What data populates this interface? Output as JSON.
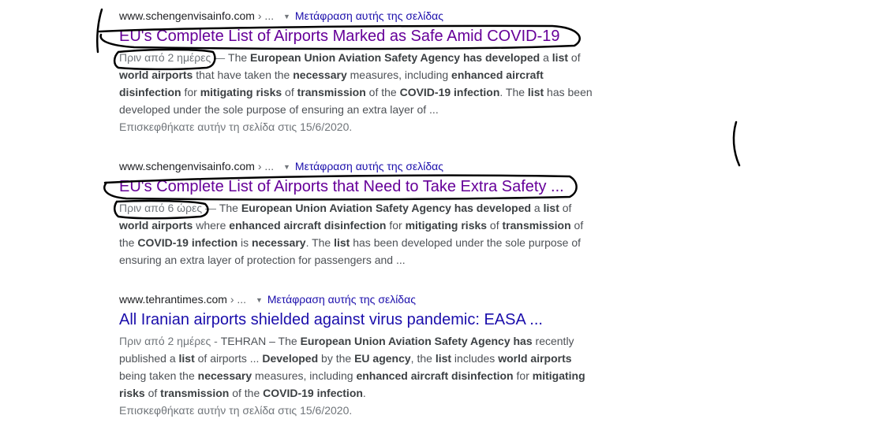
{
  "results": [
    {
      "cite_domain": "www.schengenvisainfo.com",
      "cite_path": " › ...",
      "translate_label": "Μετάφραση αυτής της σελίδας",
      "title": "EU's Complete List of Airports Marked as Safe Amid COVID-19",
      "date": "Πριν από 2 ημέρες",
      "date_sep": " — ",
      "snippet_parts": [
        {
          "t": "The ",
          "b": false
        },
        {
          "t": "European Union Aviation Safety Agency has developed",
          "b": true
        },
        {
          "t": " a ",
          "b": false
        },
        {
          "t": "list",
          "b": true
        },
        {
          "t": " of ",
          "b": false
        },
        {
          "t": "world airports",
          "b": true
        },
        {
          "t": " that have taken the ",
          "b": false
        },
        {
          "t": "necessary",
          "b": true
        },
        {
          "t": " measures, including ",
          "b": false
        },
        {
          "t": "enhanced aircraft disinfection",
          "b": true
        },
        {
          "t": " for ",
          "b": false
        },
        {
          "t": "mitigating risks",
          "b": true
        },
        {
          "t": " of ",
          "b": false
        },
        {
          "t": "transmission",
          "b": true
        },
        {
          "t": " of the ",
          "b": false
        },
        {
          "t": "COVID-19 infection",
          "b": true
        },
        {
          "t": ". The ",
          "b": false
        },
        {
          "t": "list",
          "b": true
        },
        {
          "t": " has been developed under the sole purpose of ensuring an extra layer of ...",
          "b": false
        }
      ],
      "visited_note": "Επισκεφθήκατε αυτήν τη σελίδα στις 15/6/2020."
    },
    {
      "cite_domain": "www.schengenvisainfo.com",
      "cite_path": " › ...",
      "translate_label": "Μετάφραση αυτής της σελίδας",
      "title": "EU's Complete List of Airports that Need to Take Extra Safety ...",
      "date": "Πριν από 6 ώρες",
      "date_sep": " — ",
      "snippet_parts": [
        {
          "t": "The ",
          "b": false
        },
        {
          "t": "European Union Aviation Safety Agency has developed",
          "b": true
        },
        {
          "t": " a ",
          "b": false
        },
        {
          "t": "list",
          "b": true
        },
        {
          "t": " of ",
          "b": false
        },
        {
          "t": "world airports",
          "b": true
        },
        {
          "t": " where ",
          "b": false
        },
        {
          "t": "enhanced aircraft disinfection",
          "b": true
        },
        {
          "t": " for ",
          "b": false
        },
        {
          "t": "mitigating risks",
          "b": true
        },
        {
          "t": " of ",
          "b": false
        },
        {
          "t": "transmission",
          "b": true
        },
        {
          "t": " of the ",
          "b": false
        },
        {
          "t": "COVID-19 infection",
          "b": true
        },
        {
          "t": " is ",
          "b": false
        },
        {
          "t": "necessary",
          "b": true
        },
        {
          "t": ". The ",
          "b": false
        },
        {
          "t": "list",
          "b": true
        },
        {
          "t": " has been developed under the sole purpose of ensuring an extra layer of protection for passengers and ...",
          "b": false
        }
      ],
      "visited_note": ""
    },
    {
      "cite_domain": "www.tehrantimes.com",
      "cite_path": " › ...",
      "translate_label": "Μετάφραση αυτής της σελίδας",
      "title": "All Iranian airports shielded against virus pandemic: EASA ...",
      "date": "Πριν από 2 ημέρες",
      "date_sep": " - ",
      "snippet_parts": [
        {
          "t": "TEHRAN – The ",
          "b": false
        },
        {
          "t": "European Union Aviation Safety Agency has",
          "b": true
        },
        {
          "t": " recently published a ",
          "b": false
        },
        {
          "t": "list",
          "b": true
        },
        {
          "t": " of airports ... ",
          "b": false
        },
        {
          "t": "Developed",
          "b": true
        },
        {
          "t": " by the ",
          "b": false
        },
        {
          "t": "EU agency",
          "b": true
        },
        {
          "t": ", the ",
          "b": false
        },
        {
          "t": "list",
          "b": true
        },
        {
          "t": " includes ",
          "b": false
        },
        {
          "t": "world airports",
          "b": true
        },
        {
          "t": " being taken the ",
          "b": false
        },
        {
          "t": "necessary",
          "b": true
        },
        {
          "t": " measures, including ",
          "b": false
        },
        {
          "t": "enhanced aircraft disinfection",
          "b": true
        },
        {
          "t": " for ",
          "b": false
        },
        {
          "t": "mitigating risks",
          "b": true
        },
        {
          "t": " of ",
          "b": false
        },
        {
          "t": "transmission",
          "b": true
        },
        {
          "t": " of the ",
          "b": false
        },
        {
          "t": "COVID-19 infection",
          "b": true
        },
        {
          "t": ".",
          "b": false
        }
      ],
      "visited_note": "Επισκεφθήκατε αυτήν τη σελίδα στις 15/6/2020."
    }
  ]
}
